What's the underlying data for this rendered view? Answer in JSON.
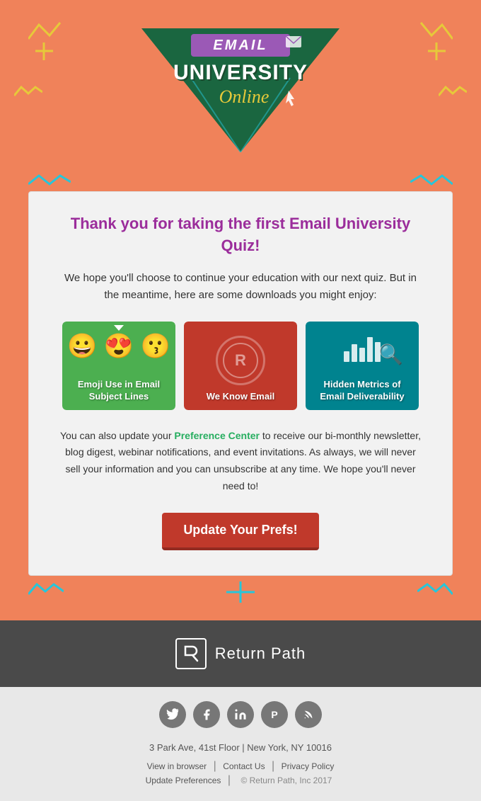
{
  "header": {
    "logo": {
      "email_label": "EMAIL",
      "university_label": "UNIVERSITY",
      "online_label": "Online"
    }
  },
  "main": {
    "title": "Thank you for taking the first Email University Quiz!",
    "subtitle": "We hope you'll choose to continue your education with our next quiz. But in the meantime, here are some downloads you might enjoy:",
    "downloads": [
      {
        "id": "emoji",
        "label": "Emoji Use in Email Subject Lines",
        "bg_color": "#4caf50"
      },
      {
        "id": "wke",
        "label": "We Know Email",
        "bg_color": "#c0392b"
      },
      {
        "id": "metrics",
        "label": "Hidden Metrics of Email Deliverability",
        "bg_color": "#00838f"
      }
    ],
    "body_text_before_link": "You can also update your ",
    "pref_link_label": "Preference Center",
    "body_text_after_link": " to receive our bi-monthly newsletter, blog digest, webinar notifications, and event invitations. As always, we will never sell your information and you can unsubscribe at any time. We hope you'll never need to!",
    "cta_label": "Update Your Prefs!"
  },
  "footer_dark": {
    "brand_name": "Return Path",
    "rp_symbol": "R"
  },
  "footer_light": {
    "address": "3 Park Ave, 41st Floor  |  New York, NY 10016",
    "links": [
      {
        "label": "View in browser"
      },
      {
        "label": "Contact Us"
      },
      {
        "label": "Privacy Policy"
      }
    ],
    "links2": [
      {
        "label": "Update Preferences"
      }
    ],
    "copyright": "© Return Path, Inc 2017"
  },
  "social": [
    {
      "name": "twitter",
      "symbol": "🐦"
    },
    {
      "name": "facebook",
      "symbol": "f"
    },
    {
      "name": "linkedin",
      "symbol": "in"
    },
    {
      "name": "pinterest",
      "symbol": "P"
    },
    {
      "name": "rss",
      "symbol": "◉"
    }
  ]
}
